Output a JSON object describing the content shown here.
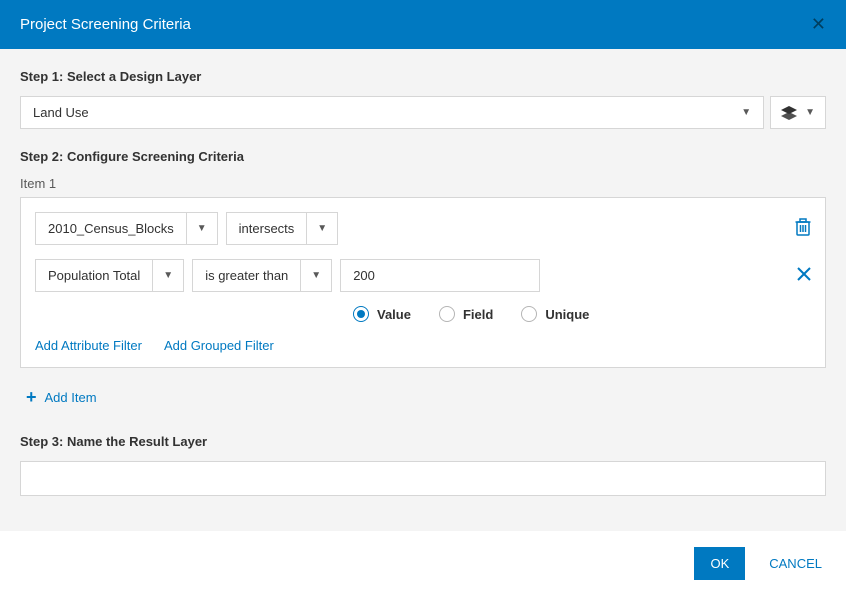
{
  "header": {
    "title": "Project Screening Criteria"
  },
  "steps": {
    "s1": "Step 1: Select a Design Layer",
    "s2": "Step 2: Configure Screening Criteria",
    "s3": "Step 3: Name the Result Layer"
  },
  "design_layer": {
    "value": "Land Use"
  },
  "item": {
    "label": "Item 1",
    "source_layer": "2010_Census_Blocks",
    "spatial_op": "intersects",
    "field": "Population Total",
    "operator": "is greater than",
    "value": "200",
    "radio": {
      "value": "Value",
      "field": "Field",
      "unique": "Unique"
    },
    "add_attr": "Add Attribute Filter",
    "add_group": "Add Grouped Filter"
  },
  "add_item": "Add Item",
  "result_layer": {
    "value": ""
  },
  "footer": {
    "ok": "OK",
    "cancel": "CANCEL"
  }
}
